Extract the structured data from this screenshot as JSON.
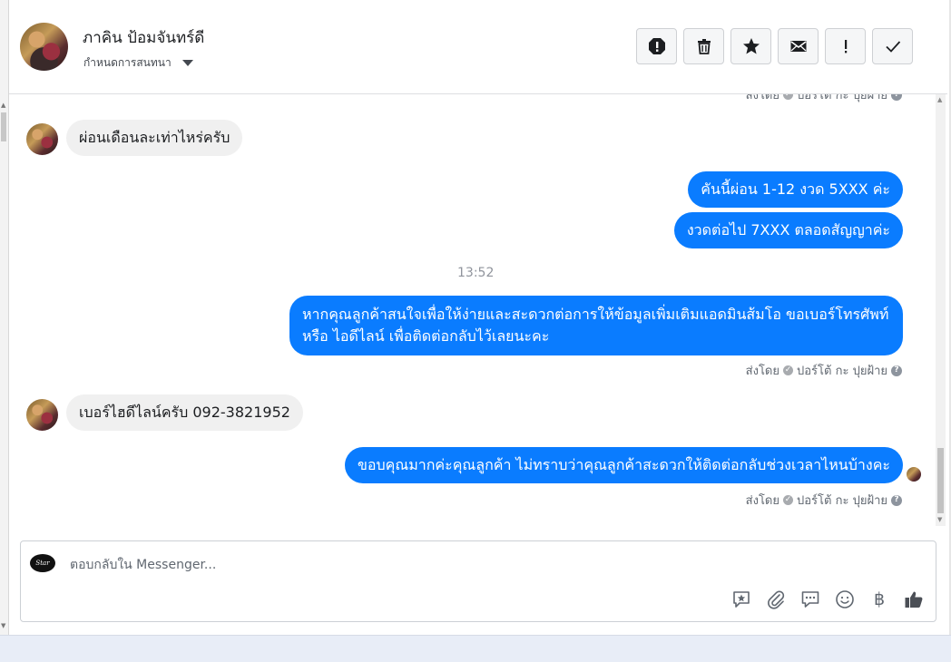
{
  "header": {
    "contact_name": "ภาคิน ป้อมจันทร์ดี",
    "assign_label": "กำหนดการสนทนา",
    "actions": [
      {
        "name": "spam-icon"
      },
      {
        "name": "trash-icon"
      },
      {
        "name": "star-icon"
      },
      {
        "name": "mail-icon"
      },
      {
        "name": "important-icon"
      },
      {
        "name": "done-icon"
      }
    ]
  },
  "messages": {
    "cut_sender": "ส่งโดย",
    "cut_sender_name": "ปอร์โต้ กะ ปุยฝ้าย",
    "in_1": "ผ่อนเดือนละเท่าไหร่ครับ",
    "out_1": "คันนี้ผ่อน 1-12 งวด 5XXX  ค่ะ",
    "out_2": "งวดต่อไป 7XXX  ตลอดสัญญาค่ะ",
    "timestamp": "13:52",
    "out_3": "หากคุณลูกค้าสนใจเพื่อให้ง่ายและสะดวกต่อการให้ข้อมูลเพิ่มเติมแอดมินส้มโอ ขอเบอร์โทรศัพท์ หรือ ไอดีไลน์ เพื่อติดต่อกลับไว้เลยนะคะ",
    "sent_by_label": "ส่งโดย",
    "sent_by_name": "ปอร์โต้ กะ ปุยฝ้าย",
    "in_2": "เบอร์ไฮดีไลน์ครับ 092-3821952",
    "out_4": "ขอบคุณมากค่ะคุณลูกค้า ไม่ทราบว่าคุณลูกค้าสะดวกให้ติดต่อกลับช่วงเวลาไหนบ้างคะ"
  },
  "composer": {
    "placeholder": "ตอบกลับใน Messenger...",
    "tools": [
      "saved-reply-icon",
      "attachment-icon",
      "chat-bubble-icon",
      "emoji-icon",
      "baht-icon",
      "thumbs-up-icon"
    ],
    "baht_symbol": "฿"
  },
  "colors": {
    "accent_blue": "#0a7cff",
    "incoming_bubble": "#f0f0f0",
    "text_secondary": "#606770"
  }
}
